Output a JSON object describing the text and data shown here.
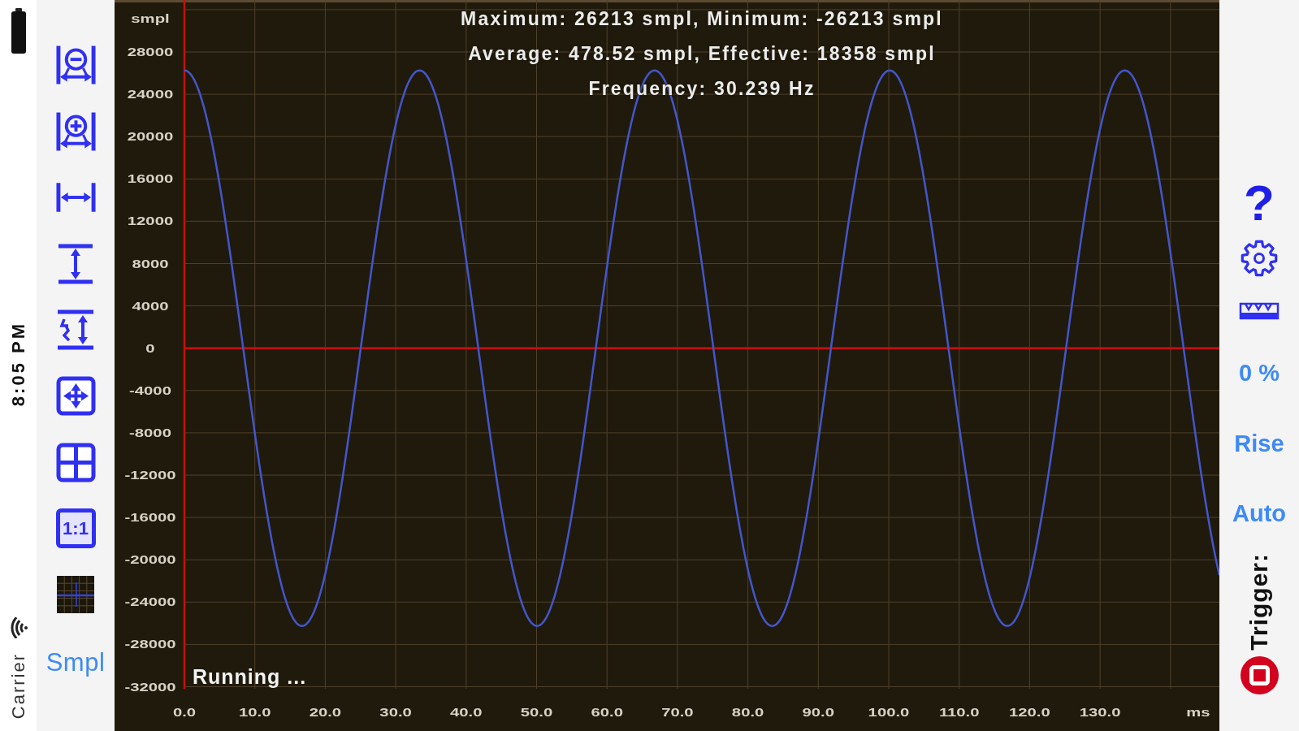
{
  "status_bar": {
    "time": "8:05 PM",
    "carrier": "Carrier"
  },
  "left_toolbar": {
    "ratio_button": "1:1",
    "unit_button": "Smpl"
  },
  "plot": {
    "y_unit": "smpl",
    "y_ticks": [
      "28000",
      "24000",
      "20000",
      "16000",
      "12000",
      "8000",
      "4000",
      "0",
      "-4000",
      "-8000",
      "-12000",
      "-16000",
      "-20000",
      "-24000",
      "-28000",
      "-32000"
    ],
    "x_ticks": [
      "0.0",
      "10.0",
      "20.0",
      "30.0",
      "40.0",
      "50.0",
      "60.0",
      "70.0",
      "80.0",
      "90.0",
      "100.0",
      "110.0",
      "120.0",
      "130.0"
    ],
    "x_unit": "ms",
    "measurements": [
      "Maximum: 26213 smpl, Minimum: -26213 smpl",
      "Average: 478.52 smpl, Effective: 18358 smpl",
      "Frequency: 30.239 Hz"
    ],
    "status": "Running ..."
  },
  "right_toolbar": {
    "help_button": "?",
    "trigger_level": "0 %",
    "trigger_edge": "Rise",
    "trigger_mode": "Auto",
    "trigger_label": "Trigger:"
  }
}
